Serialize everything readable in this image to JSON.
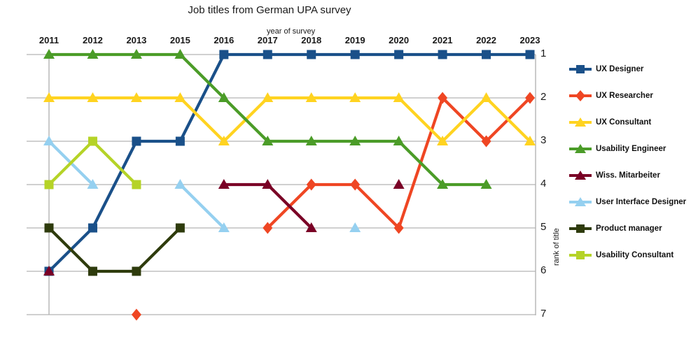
{
  "chart_data": {
    "type": "line",
    "title": "Job titles from German UPA survey",
    "xlabel": "year of survey",
    "ylabel": "rank of title",
    "categories": [
      "2011",
      "2012",
      "2013",
      "2015",
      "2016",
      "2017",
      "2018",
      "2019",
      "2020",
      "2021",
      "2022",
      "2023"
    ],
    "ylim": [
      1,
      7
    ],
    "y_inverted": true,
    "yticks": [
      "1",
      "2",
      "3",
      "4",
      "5",
      "6",
      "7"
    ],
    "grid": true,
    "legend_position": "right",
    "series": [
      {
        "name": "UX Designer",
        "color": "#1a5089",
        "marker": "square",
        "values": [
          6,
          5,
          3,
          3,
          1,
          1,
          1,
          1,
          1,
          1,
          1,
          1
        ]
      },
      {
        "name": "UX Researcher",
        "color": "#ef4623",
        "marker": "diamond",
        "values": [
          null,
          null,
          7,
          null,
          null,
          5,
          4,
          4,
          5,
          2,
          3,
          2
        ]
      },
      {
        "name": "UX Consultant",
        "color": "#ffd320",
        "marker": "triangle",
        "values": [
          2,
          2,
          2,
          2,
          3,
          2,
          2,
          2,
          2,
          3,
          2,
          3
        ]
      },
      {
        "name": "Usability Engineer",
        "color": "#4b9c28",
        "marker": "triangle",
        "values": [
          1,
          1,
          1,
          1,
          2,
          3,
          3,
          3,
          3,
          4,
          4,
          null
        ]
      },
      {
        "name": "Wiss. Mitarbeiter",
        "color": "#7a0026",
        "marker": "triangle",
        "values": [
          6,
          null,
          null,
          null,
          4,
          4,
          5,
          null,
          4,
          null,
          null,
          null
        ]
      },
      {
        "name": "User Interface Designer",
        "color": "#95d0f0",
        "marker": "triangle",
        "values": [
          3,
          4,
          null,
          4,
          5,
          null,
          null,
          5,
          null,
          null,
          null,
          null
        ]
      },
      {
        "name": "Product manager",
        "color": "#2e3b0c",
        "marker": "square",
        "values": [
          5,
          6,
          6,
          5,
          null,
          null,
          null,
          null,
          null,
          null,
          null,
          null
        ]
      },
      {
        "name": "Usability Consultant",
        "color": "#b5d327",
        "marker": "square",
        "values": [
          4,
          3,
          4,
          null,
          null,
          null,
          null,
          null,
          null,
          null,
          null,
          null
        ]
      }
    ]
  }
}
